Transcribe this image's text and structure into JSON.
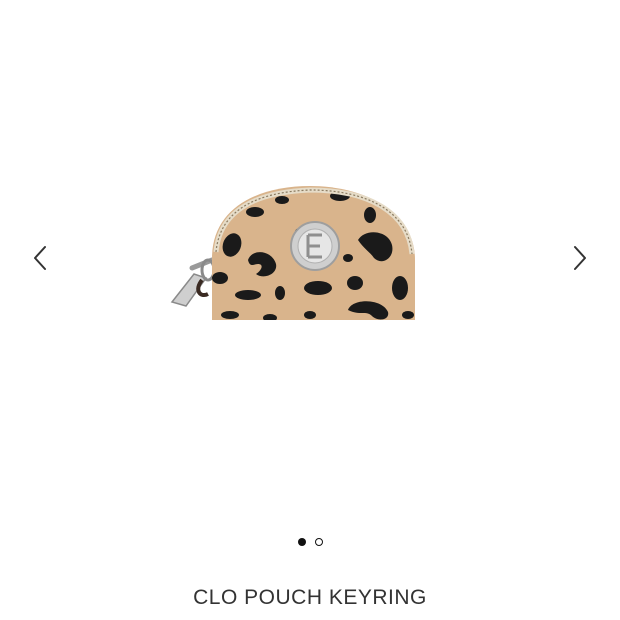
{
  "product": {
    "title": "CLO POUCH KEYRING",
    "image_alt": "leopard print half-moon pouch keyring"
  },
  "carousel": {
    "slide_count": 2,
    "active_index": 0,
    "prev_icon": "chevron-left-icon",
    "next_icon": "chevron-right-icon"
  },
  "colors": {
    "pouch_base": "#d9b48c",
    "spots": "#1a1a1a",
    "hardware": "#c8c8c8",
    "text": "#333333"
  }
}
